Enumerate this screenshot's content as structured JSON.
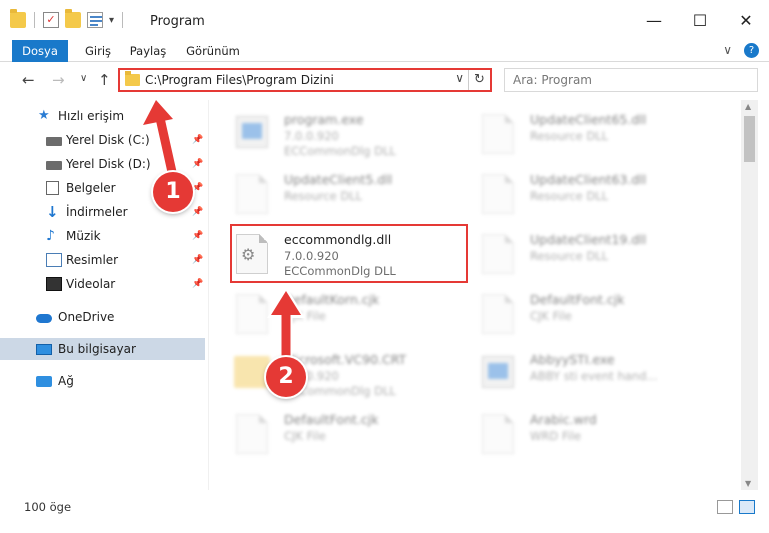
{
  "window": {
    "title": "Program",
    "controls": {
      "minimize": "—",
      "maximize": "☐",
      "close": "✕"
    }
  },
  "ribbon": {
    "tabs": [
      "Dosya",
      "Giriş",
      "Paylaş",
      "Görünüm"
    ],
    "expand": "∨",
    "help": "?"
  },
  "nav": {
    "back": "←",
    "forward": "→",
    "recent": "∨",
    "up": "↑",
    "address": "C:\\Program Files\\Program Dizini",
    "address_dropdown": "∨",
    "refresh": "↻",
    "search_placeholder": "Ara: Program"
  },
  "sidebar": {
    "items": [
      {
        "label": "Hızlı erişim",
        "icon": "star-icon"
      },
      {
        "label": "Yerel Disk (C:)",
        "icon": "drive-icon",
        "pinned": true
      },
      {
        "label": "Yerel Disk (D:)",
        "icon": "drive-icon",
        "pinned": true
      },
      {
        "label": "Belgeler",
        "icon": "documents-icon",
        "pinned": true
      },
      {
        "label": "İndirmeler",
        "icon": "download-icon",
        "pinned": true
      },
      {
        "label": "Müzik",
        "icon": "music-icon",
        "pinned": true
      },
      {
        "label": "Resimler",
        "icon": "pictures-icon",
        "pinned": true
      },
      {
        "label": "Videolar",
        "icon": "videos-icon",
        "pinned": true
      },
      {
        "label": "OneDrive",
        "icon": "cloud-icon"
      },
      {
        "label": "Bu bilgisayar",
        "icon": "computer-icon",
        "selected": true
      },
      {
        "label": "Ağ",
        "icon": "network-icon"
      }
    ],
    "pin_glyph": "📌"
  },
  "files": [
    {
      "name": "program.exe",
      "line2": "7.0.0.920",
      "line3": "ECCommonDlg DLL",
      "kind": "exe"
    },
    {
      "name": "UpdateClient65.dll",
      "line2": "Resource DLL",
      "line3": "",
      "kind": "dll"
    },
    {
      "name": "UpdateClient5.dll",
      "line2": "Resource DLL",
      "line3": "",
      "kind": "dll"
    },
    {
      "name": "UpdateClient63.dll",
      "line2": "Resource DLL",
      "line3": "",
      "kind": "dll"
    },
    {
      "name": "eccommondlg.dll",
      "line2": "7.0.0.920",
      "line3": "ECCommonDlg DLL",
      "kind": "dll",
      "highlighted": true
    },
    {
      "name": "UpdateClient19.dll",
      "line2": "Resource DLL",
      "line3": "",
      "kind": "dll"
    },
    {
      "name": "DefaultKorn.cjk",
      "line2": "CJK File",
      "line3": "",
      "kind": "file"
    },
    {
      "name": "DefaultFont.cjk",
      "line2": "CJK File",
      "line3": "",
      "kind": "file"
    },
    {
      "name": "Microsoft.VC90.CRT",
      "line2": "7.0.0.920",
      "line3": "ECCommonDlg DLL",
      "kind": "folder"
    },
    {
      "name": "AbbyySTI.exe",
      "line2": "ABBY sti event hand...",
      "line3": "",
      "kind": "exe"
    },
    {
      "name": "DefaultFont.cjk",
      "line2": "CJK File",
      "line3": "",
      "kind": "file"
    },
    {
      "name": "Arabic.wrd",
      "line2": "WRD File",
      "line3": "",
      "kind": "file"
    }
  ],
  "status": {
    "count": "100 öge"
  },
  "annotations": {
    "step1": "1",
    "step2": "2",
    "accent": "#e53935"
  }
}
